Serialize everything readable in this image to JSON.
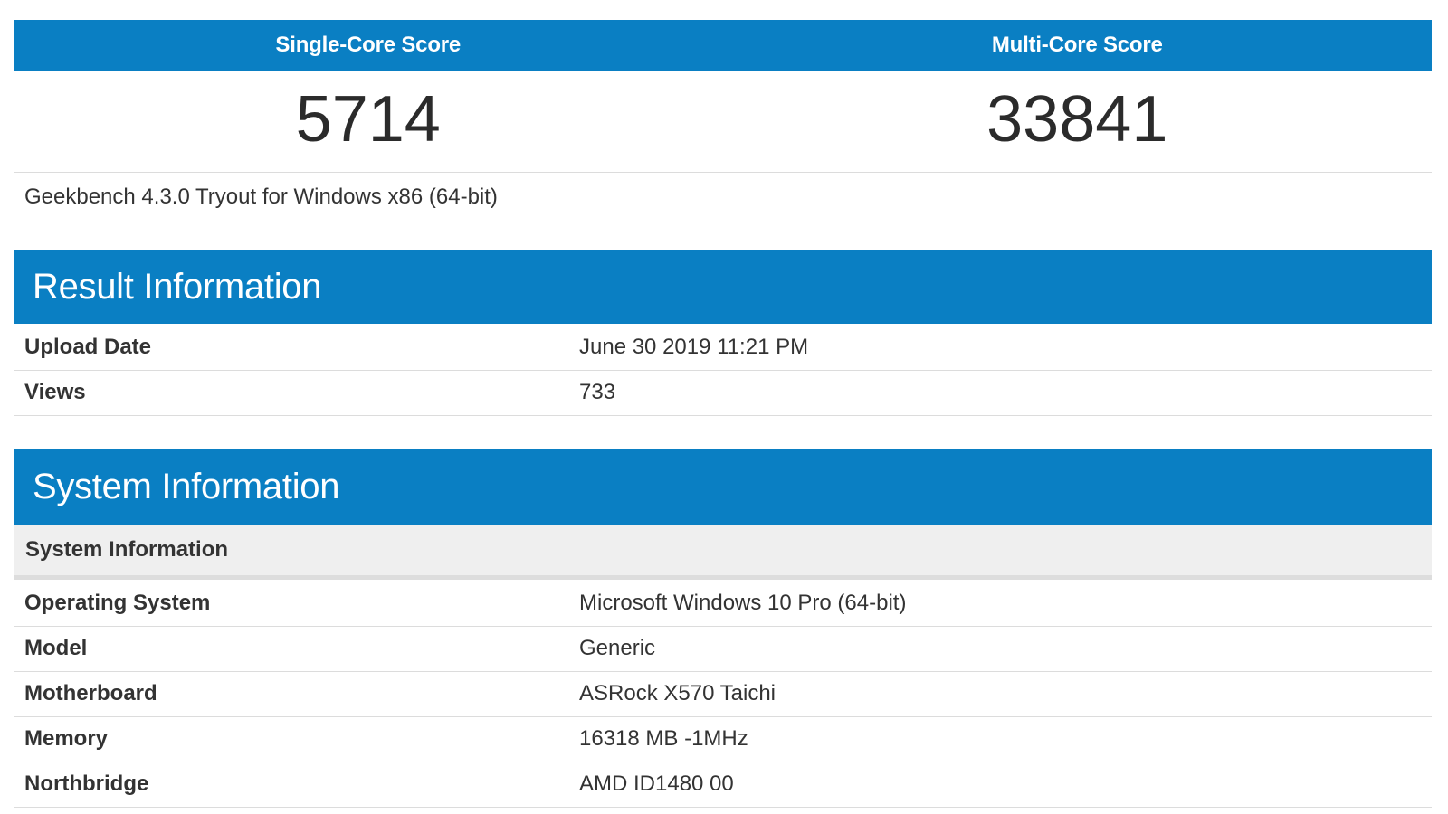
{
  "scores": {
    "single_core_label": "Single-Core Score",
    "multi_core_label": "Multi-Core Score",
    "single_core_value": "5714",
    "multi_core_value": "33841"
  },
  "version_text": "Geekbench 4.3.0 Tryout for Windows x86 (64-bit)",
  "result_information": {
    "title": "Result Information",
    "rows": [
      {
        "key": "Upload Date",
        "value": "June 30 2019 11:21 PM"
      },
      {
        "key": "Views",
        "value": "733"
      }
    ]
  },
  "system_information": {
    "title": "System Information",
    "subheader": "System Information",
    "rows": [
      {
        "key": "Operating System",
        "value": "Microsoft Windows 10 Pro (64-bit)"
      },
      {
        "key": "Model",
        "value": "Generic"
      },
      {
        "key": "Motherboard",
        "value": "ASRock X570 Taichi"
      },
      {
        "key": "Memory",
        "value": "16318 MB -1MHz"
      },
      {
        "key": "Northbridge",
        "value": "AMD ID1480 00"
      }
    ]
  },
  "colors": {
    "header_blue": "#0a7fc3",
    "subheader_gray": "#efefef"
  }
}
